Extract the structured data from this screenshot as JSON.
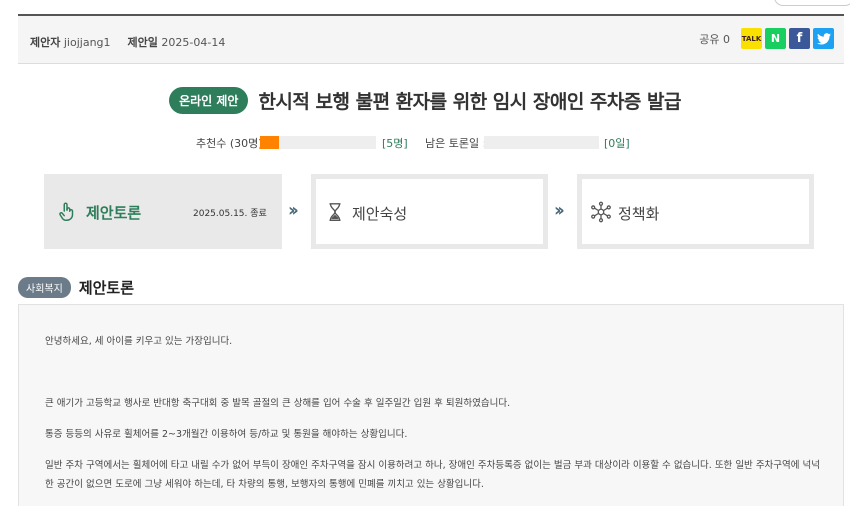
{
  "meta": {
    "proposer_label": "제안자",
    "proposer": "jiojjang1",
    "date_label": "제안일",
    "date": "2025-04-14",
    "share_label": "공유 0"
  },
  "share_icons": [
    "kakao-talk-icon",
    "naver-icon",
    "facebook-icon",
    "twitter-icon"
  ],
  "share_glyphs": {
    "kakao": "TALK",
    "naver": "N",
    "facebook": "f",
    "twitter": "t"
  },
  "title": {
    "badge": "온라인 제안",
    "text": "한시적 보행 불편 환자를 위한 임시 장애인 주차증 발급"
  },
  "stats": {
    "recommend_label": "추천수 (30명):",
    "recommend_value": "[5명]",
    "recommend_progress": 0.1667,
    "remaining_label": "남은 토론일 :",
    "remaining_value": "[0일]",
    "remaining_progress": 0
  },
  "steps": [
    {
      "label": "제안토론",
      "date": "2025.05.15. 종료",
      "icon": "hand-pointer-icon",
      "active": true
    },
    {
      "label": "제안숙성",
      "icon": "hourglass-icon",
      "active": false
    },
    {
      "label": "정책화",
      "icon": "network-icon",
      "active": false
    }
  ],
  "section": {
    "category": "사회복지",
    "title": "제안토론"
  },
  "body": {
    "p1": "안녕하세요, 세 아이를 키우고 있는 가장입니다.",
    "p2": "큰 애기가 고등학교 행사로 반대항 축구대회 중 발목 골절의 큰 상해를 입어 수술 후 일주일간 입원 후 퇴원하였습니다.",
    "p3": "통증 등등의 사유로 휠체어를 2~3개월간 이용하여 등/하교 및 통원을 해야하는 상황입니다.",
    "p4a": "일반 주차 구역에서는 휠체어에 타고 내릴 수가 없어 부득이 장애인 주차구역을 잠시 이용하려고 하나, 장애인 주차등록증 없이는 벌금 부과 대상이라 이용할 수 없습니다. 또한 일반 주차구역에 넉넉",
    "p4b": "한 공간이 없으면 도로에 그냥 세워야 하는데, 타 차량의 통행, 보행자의 통행에 민폐를 끼치고 있는 상황입니다."
  },
  "colors": {
    "accent": "#2e7d5b",
    "progress": "#ff8200",
    "badge_gray": "#6b7b8a"
  }
}
